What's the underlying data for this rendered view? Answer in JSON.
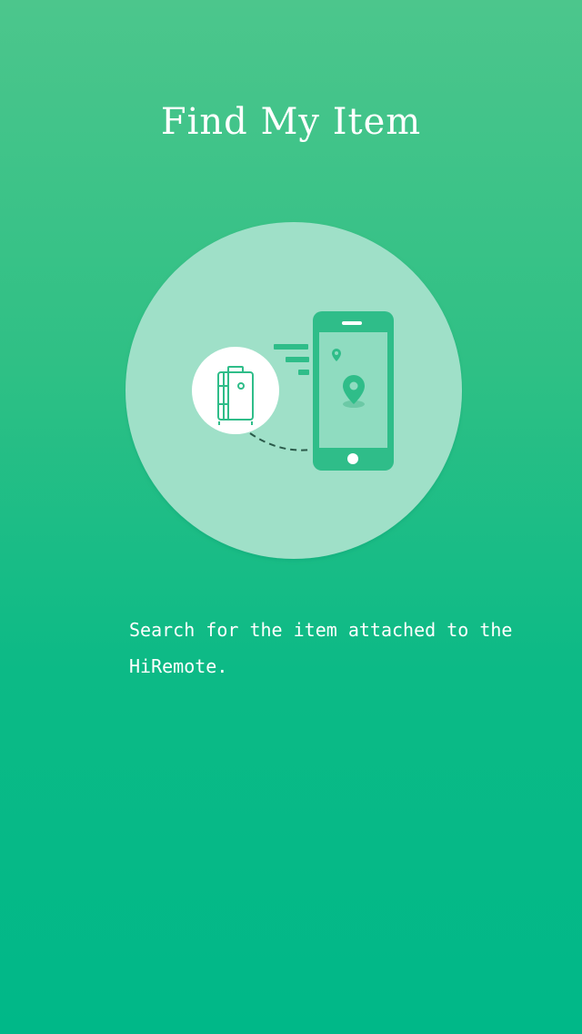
{
  "screen": {
    "title": "Find My Item",
    "description": "Search for the item attached to the HiRemote."
  },
  "illustration": {
    "icons": [
      "luggage-icon",
      "smartphone-icon",
      "location-pin-icon",
      "signal-lines-icon"
    ]
  },
  "colors": {
    "background_top": "#4cc68c",
    "background_bottom": "#00b888",
    "circle_fill": "#9fe0c8",
    "accent": "#2fbd89",
    "screen_fill": "#8fdcc0",
    "white": "#ffffff"
  }
}
